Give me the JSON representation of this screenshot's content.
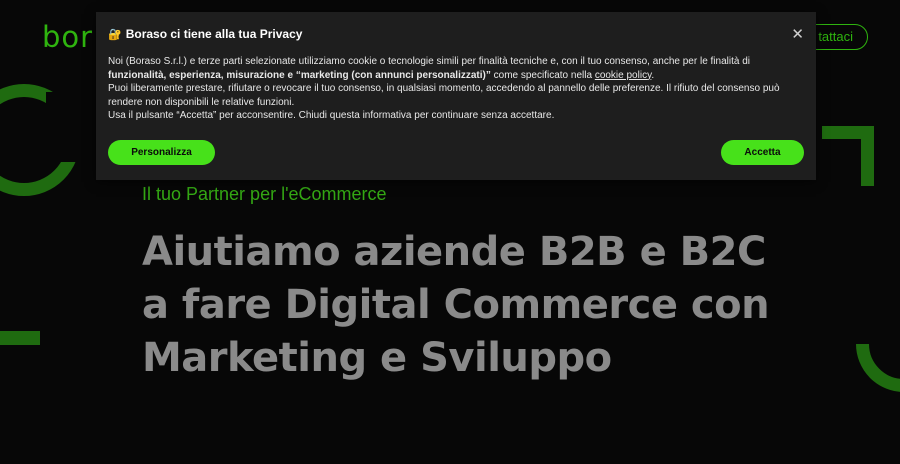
{
  "header": {
    "logo_text": "bor",
    "contact_label": "tattaci"
  },
  "hero": {
    "tagline": "Il tuo Partner per l'eCommerce",
    "title": "Aiutiamo aziende B2B e B2C a fare Digital Commerce con Marketing e Sviluppo"
  },
  "cookie": {
    "icon": "lock-icon",
    "title": "Boraso ci tiene alla tua Privacy",
    "close_label": "✕",
    "p1_start": "Noi (Boraso S.r.l.) e terze parti selezionate utilizziamo cookie o tecnologie simili per finalità tecniche e, con il tuo consenso, anche per le finalità di ",
    "p1_bold": "funzionalità, esperienza, misurazione e “marketing (con annunci personalizzati)”",
    "p1_mid": " come specificato nella ",
    "p1_link": "cookie policy",
    "p1_end": ".",
    "p2": "Puoi liberamente prestare, rifiutare o revocare il tuo consenso, in qualsiasi momento, accedendo al pannello delle preferenze. Il rifiuto del consenso può rendere non disponibili le relative funzioni.",
    "p3": "Usa il pulsante “Accetta” per acconsentire. Chiudi questa informativa per continuare senza accettare.",
    "personalize_label": "Personalizza",
    "accept_label": "Accetta"
  },
  "colors": {
    "accent": "#47e11a",
    "brand_green": "#2fb40f",
    "banner_bg": "#1e1e1e",
    "page_bg": "#070707"
  }
}
